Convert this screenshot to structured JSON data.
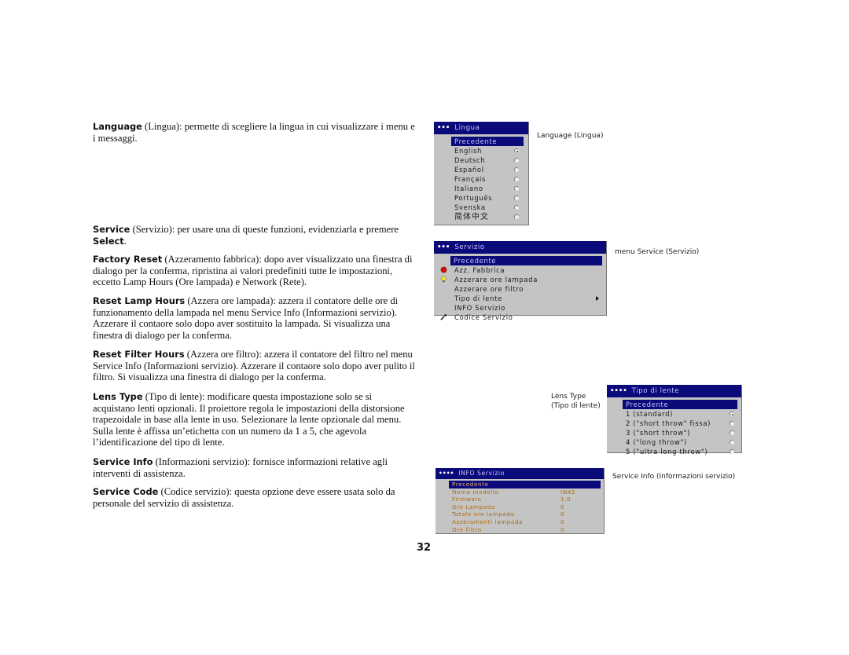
{
  "paragraphs": {
    "language": {
      "term": "Language",
      "text": " (Lingua): permette di scegliere la lingua in cui visualizzare i menu e i messaggi."
    },
    "service": {
      "term": "Service",
      "text": " (Servizio): per usare una di queste funzioni, evidenziarla e premere ",
      "term2": "Select",
      "text2": "."
    },
    "factory_reset": {
      "term": "Factory Reset",
      "text": " (Azzeramento fabbrica): dopo aver visualizzato una finestra di dialogo per la conferma, ripristina ai valori predefiniti tutte le impostazioni, eccetto Lamp Hours (Ore lampada) e Network (Rete)."
    },
    "reset_lamp_hours": {
      "term": "Reset Lamp Hours",
      "text": " (Azzera ore lampada): azzera il contatore delle ore di funzionamento della lampada nel menu Service Info (Informazioni servizio). Azzerare il contaore solo dopo aver sostituito la lampada. Si visualizza una finestra di dialogo per la conferma."
    },
    "reset_filter_hours": {
      "term": "Reset Filter Hours",
      "text": " (Azzera ore filtro): azzera il contatore del filtro nel menu Service Info (Informazioni servizio). Azzerare il contaore solo dopo aver pulito il filtro. Si visualizza una finestra di dialogo per la conferma."
    },
    "lens_type": {
      "term": "Lens Type",
      "text": " (Tipo di lente): modificare questa impostazione solo se si acquistano lenti opzionali. Il proiettore regola le impostazioni della distorsione trapezoidale in base alla lente in uso. Selezionare la lente opzionale dal menu. Sulla lente è affissa un’etichetta con un numero da 1 a 5, che agevola l’identificazione del tipo di lente."
    },
    "service_info": {
      "term": "Service Info",
      "text": " (Informazioni servizio): fornisce informazioni relative agli interventi di assistenza."
    },
    "service_code": {
      "term": "Service Code",
      "text": " (Codice servizio): questa opzione deve essere usata solo da personale del servizio di assistenza."
    }
  },
  "captions": {
    "language": "Language (Lingua)",
    "service": "menu Service (Servizio)",
    "lens_line1": "Lens Type",
    "lens_line2": "(Tipo di lente)",
    "service_info": "Service Info (Informazioni servizio)"
  },
  "menus": {
    "lingua": {
      "title": "Lingua",
      "dots": "•••",
      "items": [
        {
          "label": "Precedente",
          "selected": true
        },
        {
          "label": "English",
          "radio": true,
          "checked": true
        },
        {
          "label": "Deutsch",
          "radio": true
        },
        {
          "label": "Español",
          "radio": true
        },
        {
          "label": "Français",
          "radio": true
        },
        {
          "label": "Italiano",
          "radio": true
        },
        {
          "label": "Português",
          "radio": true
        },
        {
          "label": "Svenska",
          "radio": true
        },
        {
          "label": "简体中文",
          "radio": true
        }
      ]
    },
    "servizio": {
      "title": "Servizio",
      "dots": "•••",
      "items": [
        {
          "label": "Precedente",
          "selected": true
        },
        {
          "label": "Azz. Fabbrica",
          "icon": "red-dot-icon"
        },
        {
          "label": "Azzerare ore lampada",
          "icon": "lightbulb-icon"
        },
        {
          "label": "Azzerare ore filtro"
        },
        {
          "label": "Tipo di lente",
          "submenu": true
        },
        {
          "label": "INFO Servizio"
        },
        {
          "label": "Codice Servizio",
          "icon": "wrench-icon"
        }
      ]
    },
    "lente": {
      "title": "Tipo di lente",
      "dots": "••••",
      "items": [
        {
          "label": "Precedente",
          "selected": true
        },
        {
          "label": "1 (standard)",
          "radio": true,
          "checked": true
        },
        {
          "label": "2 (\"short throw\" fissa)",
          "radio": true
        },
        {
          "label": "3 (\"short throw\")",
          "radio": true
        },
        {
          "label": "4 (\"long throw\")",
          "radio": true
        },
        {
          "label": "5 (\"ultra long throw\")",
          "radio": true
        }
      ]
    },
    "info": {
      "title": "INFO Servizio",
      "dots": "••••",
      "items": [
        {
          "label": "Precedente",
          "selected": true
        },
        {
          "label": "Nome modello",
          "value": "IN42"
        },
        {
          "label": "Firmware",
          "value": "1.0"
        },
        {
          "label": "Ore Lampada",
          "value": "0"
        },
        {
          "label": "Totale ore lampada",
          "value": "0"
        },
        {
          "label": "Azzeramenti lampada",
          "value": "0"
        },
        {
          "label": "Ore filtro",
          "value": "0"
        }
      ]
    }
  },
  "page_number": "32"
}
